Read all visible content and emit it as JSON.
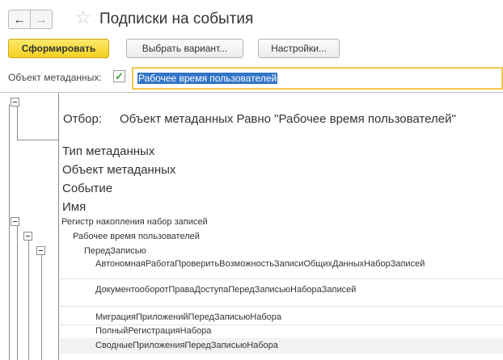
{
  "window": {
    "title": "Подписки на события"
  },
  "nav": {
    "back_glyph": "←",
    "forward_glyph": "→"
  },
  "toolbar": {
    "generate_label": "Сформировать",
    "variant_label": "Выбрать вариант...",
    "settings_label": "Настройки..."
  },
  "filter": {
    "label": "Объект метаданных:",
    "checked": true,
    "value": "Рабочее время пользователей"
  },
  "report": {
    "filter_label": "Отбор:",
    "filter_text": "Объект метаданных Равно \"Рабочее время пользователей\"",
    "headers": [
      "Тип метаданных",
      "Объект метаданных",
      "Событие",
      "Имя"
    ],
    "group1": "Регистр накопления набор записей",
    "group2": "Рабочее время пользователей",
    "group3": "ПередЗаписью",
    "items": [
      "АвтономнаяРаботаПроверитьВозможностьЗаписиОбщихДанныхНаборЗаписей",
      "ДокументооборотПраваДоступаПередЗаписьюНабораЗаписей",
      "МиграцияПриложенийПередЗаписьюНабора",
      "ПолныйРегистрацияНабора",
      "СводныеПриложенияПередЗаписьюНабора"
    ]
  },
  "colors": {
    "accent_yellow": "#f3d121",
    "selection_blue": "#3174c7",
    "focus_border": "#f3c74b"
  }
}
